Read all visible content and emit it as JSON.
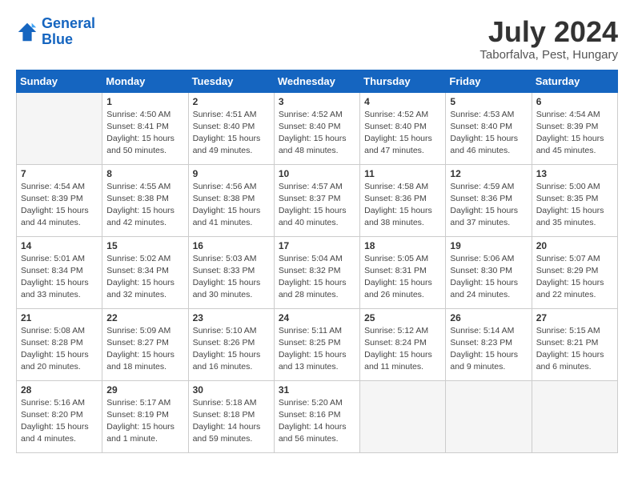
{
  "header": {
    "logo_line1": "General",
    "logo_line2": "Blue",
    "month_year": "July 2024",
    "location": "Taborfalva, Pest, Hungary"
  },
  "days_of_week": [
    "Sunday",
    "Monday",
    "Tuesday",
    "Wednesday",
    "Thursday",
    "Friday",
    "Saturday"
  ],
  "weeks": [
    [
      {
        "num": "",
        "info": ""
      },
      {
        "num": "1",
        "info": "Sunrise: 4:50 AM\nSunset: 8:41 PM\nDaylight: 15 hours\nand 50 minutes."
      },
      {
        "num": "2",
        "info": "Sunrise: 4:51 AM\nSunset: 8:40 PM\nDaylight: 15 hours\nand 49 minutes."
      },
      {
        "num": "3",
        "info": "Sunrise: 4:52 AM\nSunset: 8:40 PM\nDaylight: 15 hours\nand 48 minutes."
      },
      {
        "num": "4",
        "info": "Sunrise: 4:52 AM\nSunset: 8:40 PM\nDaylight: 15 hours\nand 47 minutes."
      },
      {
        "num": "5",
        "info": "Sunrise: 4:53 AM\nSunset: 8:40 PM\nDaylight: 15 hours\nand 46 minutes."
      },
      {
        "num": "6",
        "info": "Sunrise: 4:54 AM\nSunset: 8:39 PM\nDaylight: 15 hours\nand 45 minutes."
      }
    ],
    [
      {
        "num": "7",
        "info": "Sunrise: 4:54 AM\nSunset: 8:39 PM\nDaylight: 15 hours\nand 44 minutes."
      },
      {
        "num": "8",
        "info": "Sunrise: 4:55 AM\nSunset: 8:38 PM\nDaylight: 15 hours\nand 42 minutes."
      },
      {
        "num": "9",
        "info": "Sunrise: 4:56 AM\nSunset: 8:38 PM\nDaylight: 15 hours\nand 41 minutes."
      },
      {
        "num": "10",
        "info": "Sunrise: 4:57 AM\nSunset: 8:37 PM\nDaylight: 15 hours\nand 40 minutes."
      },
      {
        "num": "11",
        "info": "Sunrise: 4:58 AM\nSunset: 8:36 PM\nDaylight: 15 hours\nand 38 minutes."
      },
      {
        "num": "12",
        "info": "Sunrise: 4:59 AM\nSunset: 8:36 PM\nDaylight: 15 hours\nand 37 minutes."
      },
      {
        "num": "13",
        "info": "Sunrise: 5:00 AM\nSunset: 8:35 PM\nDaylight: 15 hours\nand 35 minutes."
      }
    ],
    [
      {
        "num": "14",
        "info": "Sunrise: 5:01 AM\nSunset: 8:34 PM\nDaylight: 15 hours\nand 33 minutes."
      },
      {
        "num": "15",
        "info": "Sunrise: 5:02 AM\nSunset: 8:34 PM\nDaylight: 15 hours\nand 32 minutes."
      },
      {
        "num": "16",
        "info": "Sunrise: 5:03 AM\nSunset: 8:33 PM\nDaylight: 15 hours\nand 30 minutes."
      },
      {
        "num": "17",
        "info": "Sunrise: 5:04 AM\nSunset: 8:32 PM\nDaylight: 15 hours\nand 28 minutes."
      },
      {
        "num": "18",
        "info": "Sunrise: 5:05 AM\nSunset: 8:31 PM\nDaylight: 15 hours\nand 26 minutes."
      },
      {
        "num": "19",
        "info": "Sunrise: 5:06 AM\nSunset: 8:30 PM\nDaylight: 15 hours\nand 24 minutes."
      },
      {
        "num": "20",
        "info": "Sunrise: 5:07 AM\nSunset: 8:29 PM\nDaylight: 15 hours\nand 22 minutes."
      }
    ],
    [
      {
        "num": "21",
        "info": "Sunrise: 5:08 AM\nSunset: 8:28 PM\nDaylight: 15 hours\nand 20 minutes."
      },
      {
        "num": "22",
        "info": "Sunrise: 5:09 AM\nSunset: 8:27 PM\nDaylight: 15 hours\nand 18 minutes."
      },
      {
        "num": "23",
        "info": "Sunrise: 5:10 AM\nSunset: 8:26 PM\nDaylight: 15 hours\nand 16 minutes."
      },
      {
        "num": "24",
        "info": "Sunrise: 5:11 AM\nSunset: 8:25 PM\nDaylight: 15 hours\nand 13 minutes."
      },
      {
        "num": "25",
        "info": "Sunrise: 5:12 AM\nSunset: 8:24 PM\nDaylight: 15 hours\nand 11 minutes."
      },
      {
        "num": "26",
        "info": "Sunrise: 5:14 AM\nSunset: 8:23 PM\nDaylight: 15 hours\nand 9 minutes."
      },
      {
        "num": "27",
        "info": "Sunrise: 5:15 AM\nSunset: 8:21 PM\nDaylight: 15 hours\nand 6 minutes."
      }
    ],
    [
      {
        "num": "28",
        "info": "Sunrise: 5:16 AM\nSunset: 8:20 PM\nDaylight: 15 hours\nand 4 minutes."
      },
      {
        "num": "29",
        "info": "Sunrise: 5:17 AM\nSunset: 8:19 PM\nDaylight: 15 hours\nand 1 minute."
      },
      {
        "num": "30",
        "info": "Sunrise: 5:18 AM\nSunset: 8:18 PM\nDaylight: 14 hours\nand 59 minutes."
      },
      {
        "num": "31",
        "info": "Sunrise: 5:20 AM\nSunset: 8:16 PM\nDaylight: 14 hours\nand 56 minutes."
      },
      {
        "num": "",
        "info": ""
      },
      {
        "num": "",
        "info": ""
      },
      {
        "num": "",
        "info": ""
      }
    ]
  ]
}
